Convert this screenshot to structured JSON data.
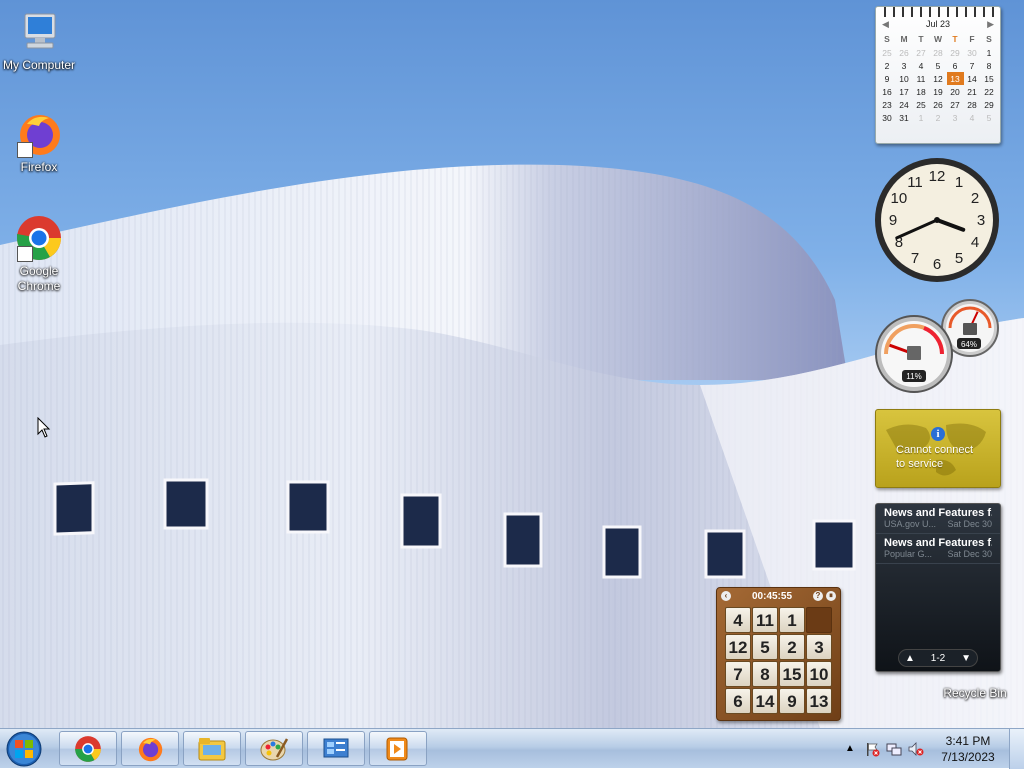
{
  "desktop_icons": [
    {
      "label": "My Computer"
    },
    {
      "label": "Firefox"
    },
    {
      "label": "Google Chrome"
    },
    {
      "label": "Recycle Bin"
    }
  ],
  "calendar": {
    "month_label": "Jul 23",
    "weekdays": [
      "S",
      "M",
      "T",
      "W",
      "T",
      "F",
      "S"
    ],
    "weeks": [
      [
        "25",
        "26",
        "27",
        "28",
        "29",
        "30",
        "1"
      ],
      [
        "2",
        "3",
        "4",
        "5",
        "6",
        "7",
        "8"
      ],
      [
        "9",
        "10",
        "11",
        "12",
        "13",
        "14",
        "15"
      ],
      [
        "16",
        "17",
        "18",
        "19",
        "20",
        "21",
        "22"
      ],
      [
        "23",
        "24",
        "25",
        "26",
        "27",
        "28",
        "29"
      ],
      [
        "30",
        "31",
        "1",
        "2",
        "3",
        "4",
        "5"
      ]
    ],
    "today": "13"
  },
  "clock": {
    "hour": 3,
    "minute": 41
  },
  "meters": {
    "cpu_label": "11%",
    "cpu_value": 11,
    "memory_label": "64%",
    "memory_value": 64
  },
  "weather": {
    "message_line1": "Cannot connect",
    "message_line2": "to service"
  },
  "feeds": {
    "items": [
      {
        "title": "News and Features f...",
        "source": "USA.gov U...",
        "date": "Sat Dec 30"
      },
      {
        "title": "News and Features f...",
        "source": "Popular G...",
        "date": "Sat Dec 30"
      }
    ],
    "page_label": "1-2"
  },
  "puzzle": {
    "timer": "00:45:55",
    "tiles": [
      "4",
      "11",
      "1",
      "",
      "12",
      "5",
      "2",
      "3",
      "7",
      "8",
      "15",
      "10",
      "6",
      "14",
      "9",
      "13"
    ]
  },
  "taskbar": {
    "pinned": [
      {
        "name": "chrome"
      },
      {
        "name": "firefox"
      },
      {
        "name": "file-explorer"
      },
      {
        "name": "paint"
      },
      {
        "name": "control-panel"
      },
      {
        "name": "media-player"
      }
    ],
    "time": "3:41 PM",
    "date": "7/13/2023"
  },
  "colors": {
    "today_highlight": "#e07a1e",
    "feed_bg": "#1a1f25",
    "weather_bg": "#c9b42a",
    "puzzle_bg": "#8a5427"
  }
}
